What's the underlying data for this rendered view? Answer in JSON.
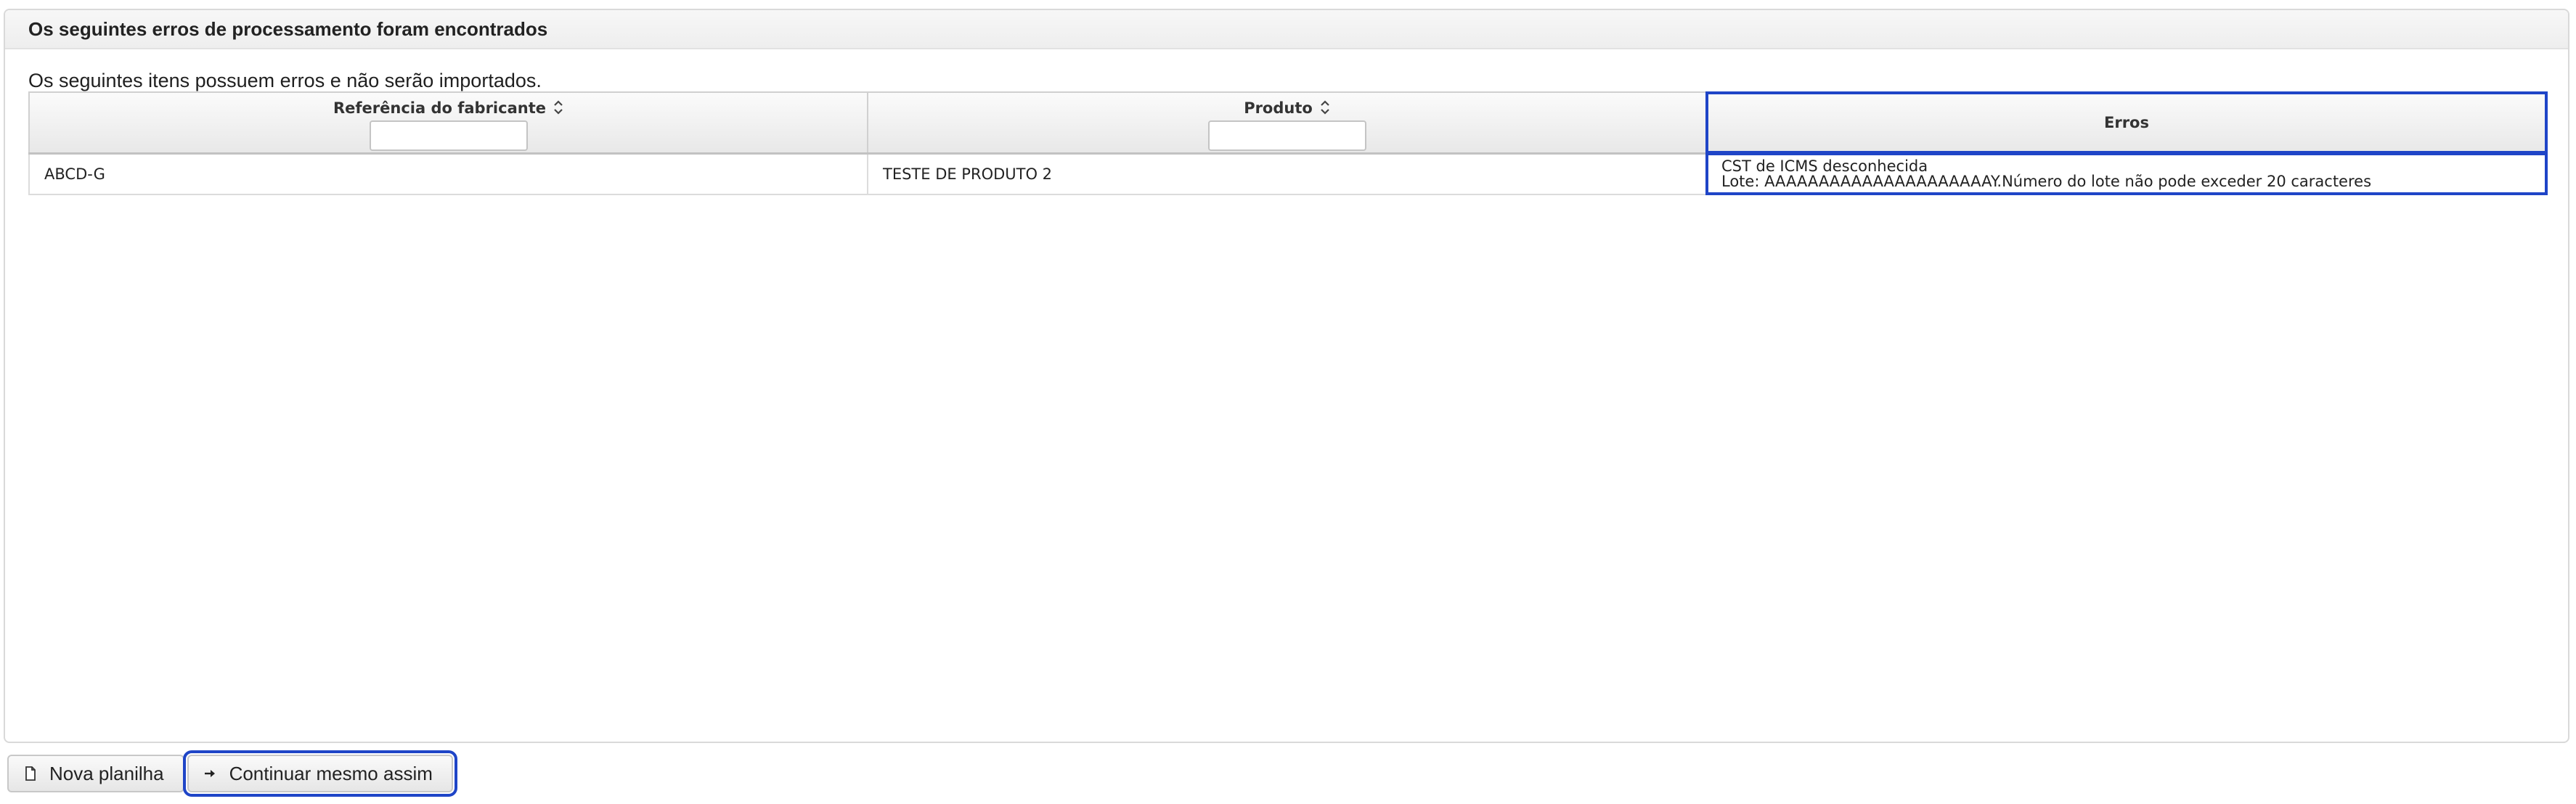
{
  "panel": {
    "title": "Os seguintes erros de processamento foram encontrados",
    "info_text": "Os seguintes itens possuem erros e não serão importados."
  },
  "table": {
    "columns": [
      {
        "label": "Referência do fabricante",
        "sortable": true,
        "filter": true,
        "filter_value": ""
      },
      {
        "label": "Produto",
        "sortable": true,
        "filter": true,
        "filter_value": ""
      },
      {
        "label": "Erros",
        "sortable": false,
        "filter": false
      }
    ],
    "rows": [
      {
        "reference": "ABCD-G",
        "product": "TESTE DE PRODUTO 2",
        "errors": [
          "CST de ICMS desconhecida",
          "Lote: AAAAAAAAAAAAAAAAAAAAAY.Número do lote não pode exceder 20 caracteres"
        ]
      }
    ]
  },
  "footer": {
    "new_sheet_label": "Nova planilha",
    "continue_label": "Continuar mesmo assim"
  },
  "colors": {
    "focus_outline": "#1f45c7",
    "header_bg": "#eeeeee"
  },
  "icons": {
    "new_sheet": "document-icon",
    "continue": "arrow-right-icon",
    "sort": "sort-icon"
  }
}
